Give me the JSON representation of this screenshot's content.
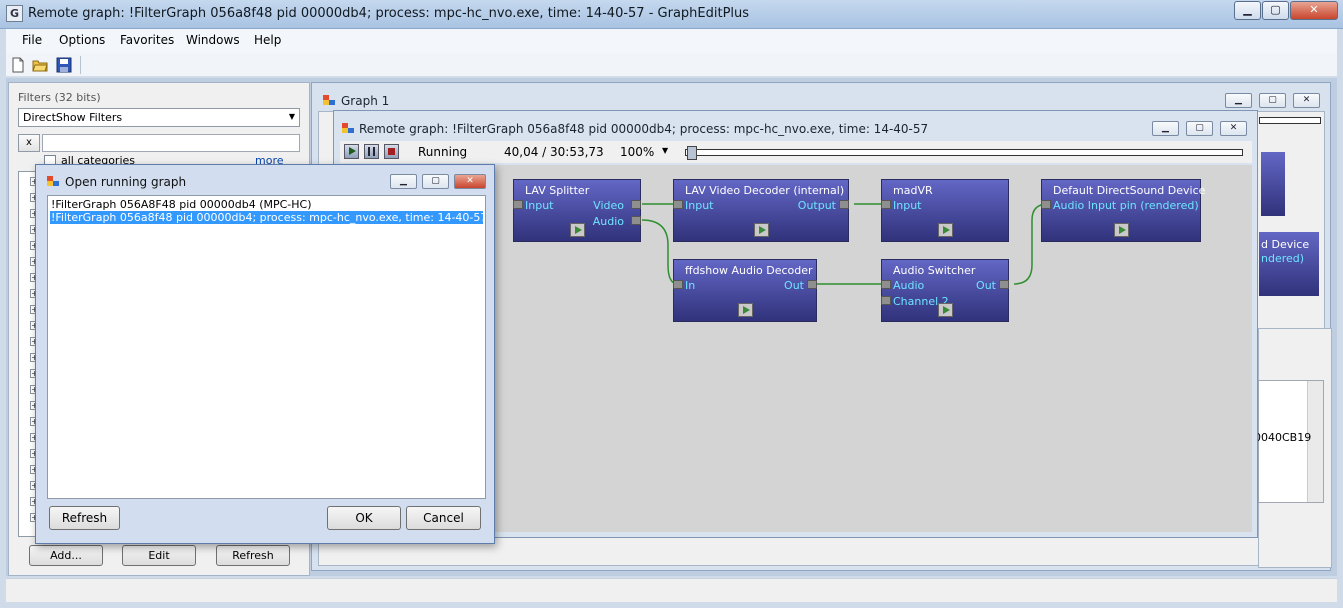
{
  "app": {
    "title": "Remote graph: !FilterGraph 056a8f48 pid 00000db4; process: mpc-hc_nvo.exe, time: 14-40-57 - GraphEditPlus",
    "icon_letter": "G"
  },
  "menu": [
    "File",
    "Options",
    "Favorites",
    "Windows",
    "Help"
  ],
  "window_buttons": {
    "minimize": "▁",
    "maximize": "▢",
    "close": "✕"
  },
  "filters_panel": {
    "label": "Filters (32 bits)",
    "category_selected": "DirectShow Filters",
    "clear_label": "x",
    "search_value": "",
    "all_categories_label": "all categories",
    "more_label": "more",
    "add_label": "Add...",
    "edit_label": "Edit",
    "refresh_label": "Refresh",
    "expander": "+"
  },
  "graph1": {
    "title": "Graph 1"
  },
  "remote_graph": {
    "title": "Remote graph: !FilterGraph 056a8f48 pid 00000db4; process: mpc-hc_nvo.exe, time: 14-40-57",
    "status": "Running",
    "time": "40,04 / 30:53,73",
    "zoom": "100%",
    "seek_position": 0.001
  },
  "nodes": {
    "lav_splitter": {
      "name": "LAV Splitter",
      "pins": {
        "input": "Input",
        "video": "Video",
        "audio": "Audio"
      }
    },
    "lav_video": {
      "name": "LAV Video Decoder (internal)",
      "pins": {
        "input": "Input",
        "output": "Output"
      }
    },
    "madvr": {
      "name": "madVR",
      "pins": {
        "input": "Input"
      }
    },
    "dsound": {
      "name": "Default DirectSound Device",
      "pins": {
        "input": "Audio Input pin (rendered)"
      }
    },
    "ffdshow": {
      "name": "ffdshow Audio Decoder",
      "pins": {
        "input": "In",
        "output": "Out"
      }
    },
    "switcher": {
      "name": "Audio Switcher",
      "pins": {
        "audio": "Audio",
        "channel2": "Channel 2",
        "output": "Out"
      }
    }
  },
  "background_fragments": {
    "device_text": "d Device",
    "rendered_text": "ndered)",
    "hex_text": "0040CB19"
  },
  "dialog": {
    "title": "Open running graph",
    "items": [
      "!FilterGraph 056A8F48 pid 00000db4 (MPC-HC)",
      "!FilterGraph 056a8f48 pid 00000db4; process: mpc-hc_nvo.exe, time: 14-40-57"
    ],
    "selected_index": 1,
    "refresh_label": "Refresh",
    "ok_label": "OK",
    "cancel_label": "Cancel"
  },
  "colors": {
    "node": "#4a4ea8",
    "pin_text": "#6ee4ff",
    "wire": "#2f8f2f",
    "selection": "#3399ff"
  }
}
